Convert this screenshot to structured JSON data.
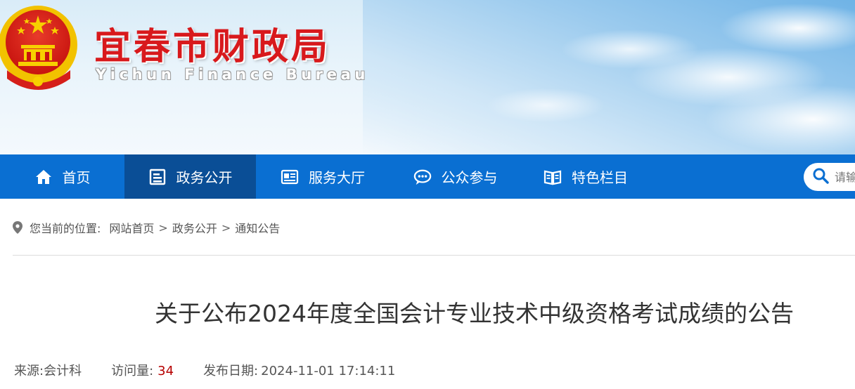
{
  "header": {
    "title": "宜春市财政局",
    "subtitle": "Yichun Finance Bureau",
    "colors": {
      "title_red": "#d8191c",
      "emblem_red": "#d51f1a",
      "emblem_gold": "#f2c200"
    }
  },
  "nav": {
    "background": "#0a6fd2",
    "active_background": "#0a4e96",
    "items": [
      {
        "label": "首页",
        "icon": "home-icon"
      },
      {
        "label": "政务公开",
        "icon": "document-icon",
        "active": true
      },
      {
        "label": "服务大厅",
        "icon": "id-card-icon"
      },
      {
        "label": "公众参与",
        "icon": "chat-bubble-icon"
      },
      {
        "label": "特色栏目",
        "icon": "book-icon"
      }
    ],
    "search": {
      "placeholder": "请输入",
      "icon": "search-icon"
    }
  },
  "breadcrumb": {
    "prefix": "您当前的位置:",
    "icon": "location-pin-icon",
    "items": [
      "网站首页",
      "政务公开",
      "通知公告"
    ],
    "separator": ">"
  },
  "article": {
    "title": "关于公布2024年度全国会计专业技术中级资格考试成绩的公告",
    "meta": {
      "source_label": "来源:",
      "source_value": "会计科",
      "views_label": "访问量:",
      "views_value": "34",
      "date_label": "发布日期:",
      "date_value": "2024-11-01 17:14:11"
    }
  }
}
